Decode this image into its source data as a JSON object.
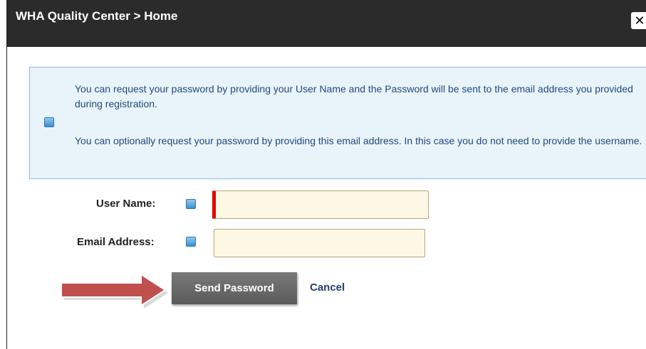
{
  "window": {
    "title": "WHA Quality Center > Home",
    "close_label": "✕"
  },
  "info": {
    "paragraph1": "You can request your password by providing your User Name and the Password will be sent to the email address you provided during registration.",
    "paragraph2": "You can optionally request your password by providing this email address. In this case you do not need to provide the username."
  },
  "form": {
    "username_label": "User Name:",
    "username_value": "",
    "email_label": "Email Address:",
    "email_value": ""
  },
  "actions": {
    "send_label": "Send Password",
    "cancel_label": "Cancel"
  },
  "colors": {
    "titlebar": "#2b2b2b",
    "info_bg": "#e9f4fa",
    "info_border": "#85bede",
    "field_bg": "#fdf8e3",
    "required_marker": "#e00000",
    "button": "#666666",
    "link": "#1c3f72",
    "arrow": "#c0504d"
  }
}
